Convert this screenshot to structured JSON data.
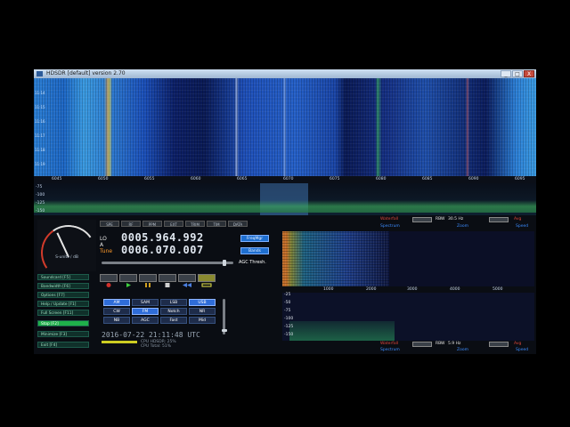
{
  "window": {
    "title": "HDSDR [default] version 2.70",
    "buttons": [
      "_",
      "□",
      "X"
    ]
  },
  "waterfall": {
    "freq_ticks": [
      "6045",
      "6050",
      "6055",
      "6060",
      "6065",
      "6070",
      "6075",
      "6080",
      "6085",
      "6090",
      "6095"
    ],
    "left_scale": [
      "11:14",
      "11:15",
      "11:16",
      "11:17",
      "11:18",
      "11:19"
    ]
  },
  "spectrum": {
    "db_ticks": [
      "-75",
      "-100",
      "-125",
      "-150"
    ]
  },
  "smeter": {
    "label": "S-units / dB"
  },
  "toprow": [
    "SPE",
    "RF",
    "PPM",
    "EXT",
    "TRIM",
    "TIM",
    "DATA"
  ],
  "lo": {
    "label": "LO A",
    "value": "0005.964.992"
  },
  "tune": {
    "label": "Tune",
    "value": "0006.070.007"
  },
  "buttons": {
    "freqmgr": "FreqMgr",
    "bands": "Bands"
  },
  "agc_label": "AGC Thresh.",
  "side_buttons": [
    "Soundcard [F5]",
    "Bandwidth [F6]",
    "Options [F7]",
    "Help / Update [F1]",
    "Full Screen [F11]",
    "Stop [F2]",
    "Minimize [F3]",
    "Exit [F4]"
  ],
  "modes": [
    "AM",
    "SAM",
    "LSB",
    "USB",
    "CW",
    "FM",
    "Notch",
    "NR",
    "NB",
    "AGC",
    "Fast",
    "Mid",
    "Slow",
    "CW Peak",
    "NB2"
  ],
  "datetime": "2016-07-22   21:11:48 UTC",
  "cpu": {
    "line1": "CPU HDSDR: 25%",
    "line2": "CPU Total: 51%"
  },
  "top_ctl": {
    "waterfall": "Waterfall",
    "rbw_label": "RBW",
    "rbw": "30.5 Hz",
    "avg": "Avg",
    "spectrum": "Spectrum",
    "zoom": "Zoom",
    "speed": "Speed"
  },
  "bottom_ctl": {
    "waterfall": "Waterfall",
    "rbw_label": "RBW",
    "rbw": "5.9 Hz",
    "avg": "Avg",
    "spectrum": "Spectrum",
    "zoom": "Zoom",
    "speed": "Speed"
  },
  "zoom_axis": [
    "1000",
    "2000",
    "3000",
    "4000",
    "5000"
  ],
  "zoom_db": [
    "-25",
    "-50",
    "-75",
    "-100",
    "-125",
    "-150"
  ],
  "colors": {
    "accent": "#1f6fd0",
    "tune_label": "#ff9a2a",
    "stop_green": "#1fb04a"
  }
}
